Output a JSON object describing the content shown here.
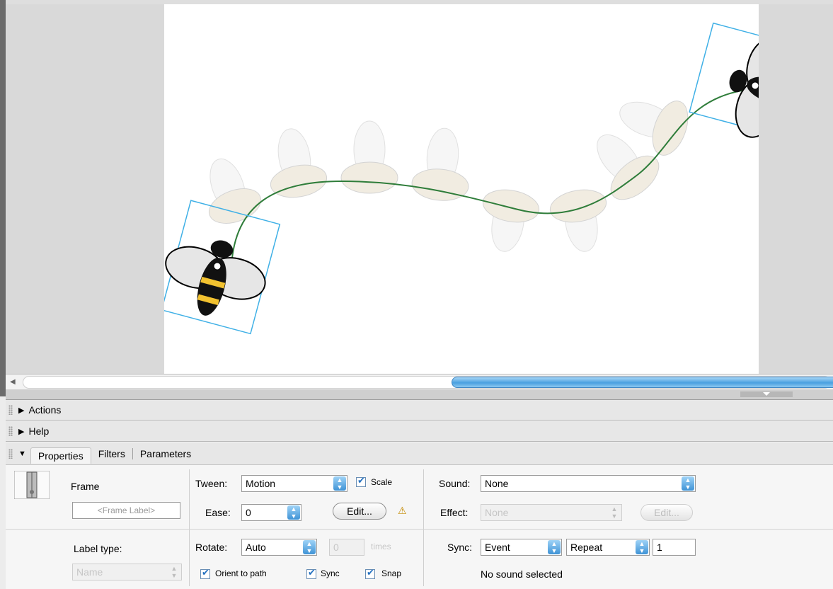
{
  "panels": {
    "actions": "Actions",
    "help": "Help",
    "tabs": [
      {
        "label": "Properties",
        "active": true
      },
      {
        "label": "Filters",
        "active": false
      },
      {
        "label": "Parameters",
        "active": false
      }
    ]
  },
  "frame_section": {
    "title": "Frame",
    "frame_label_placeholder": "<Frame Label>",
    "label_type_label": "Label type:",
    "label_type_value": "Name"
  },
  "tween_section": {
    "tween_label": "Tween:",
    "tween_value": "Motion",
    "scale_label": "Scale",
    "scale_checked": true,
    "ease_label": "Ease:",
    "ease_value": "0",
    "edit_label": "Edit...",
    "warning_icon": "warning-icon",
    "rotate_label": "Rotate:",
    "rotate_value": "Auto",
    "times_value": "0",
    "times_label": "times",
    "orient_label": "Orient to path",
    "orient_checked": true,
    "sync_label": "Sync",
    "sync_checked": true,
    "snap_label": "Snap",
    "snap_checked": true
  },
  "sound_section": {
    "sound_label": "Sound:",
    "sound_value": "None",
    "effect_label": "Effect:",
    "effect_value": "None",
    "effect_edit_label": "Edit...",
    "sync_label": "Sync:",
    "sync_value": "Event",
    "repeat_value": "Repeat",
    "repeat_count": "1",
    "status": "No sound selected"
  },
  "colors": {
    "path": "#2f7d3a",
    "selection_box": "#3fb0e6",
    "bee_stripe": "#f2c230",
    "scroll_thumb": "#4aa0e0"
  }
}
